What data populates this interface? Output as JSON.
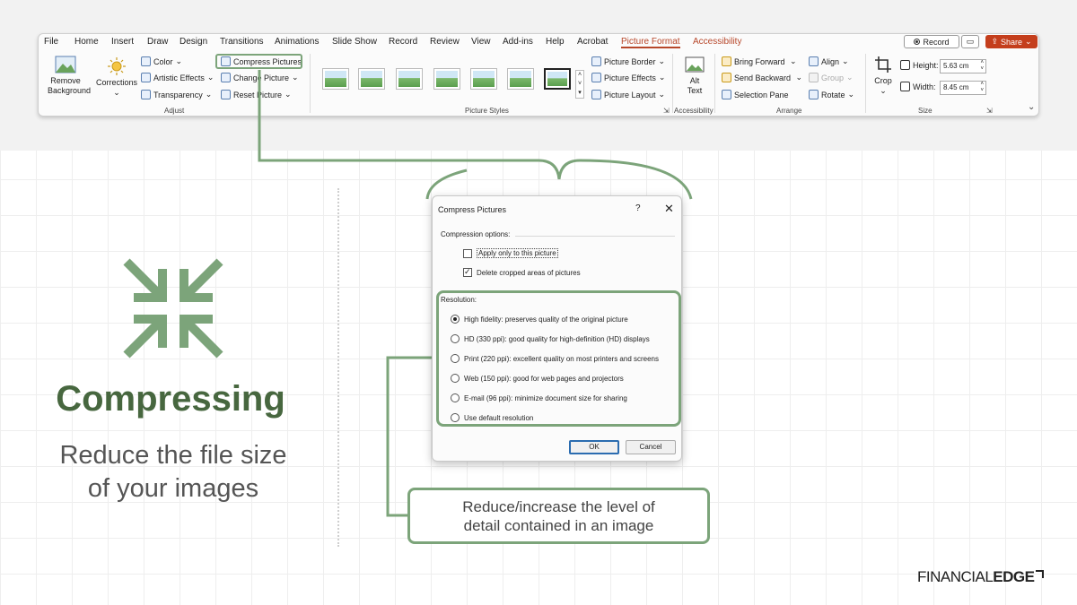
{
  "ribbon": {
    "tabs": [
      "File",
      "Home",
      "Insert",
      "Draw",
      "Design",
      "Transitions",
      "Animations",
      "Slide Show",
      "Record",
      "Review",
      "View",
      "Add-ins",
      "Help",
      "Acrobat",
      "Picture Format",
      "Accessibility"
    ],
    "record_label": "Record",
    "share_label": "Share",
    "adjust": {
      "remove_background": [
        "Remove",
        "Background"
      ],
      "corrections": "Corrections",
      "color": "Color",
      "artistic_effects": "Artistic Effects",
      "transparency": "Transparency",
      "compress_pictures": "Compress Pictures",
      "change_picture": "Change Picture",
      "reset_picture": "Reset Picture",
      "group_label": "Adjust"
    },
    "picture_styles": {
      "picture_border": "Picture Border",
      "picture_effects": "Picture Effects",
      "picture_layout": "Picture Layout",
      "group_label": "Picture Styles"
    },
    "accessibility": {
      "alt_text": [
        "Alt",
        "Text"
      ],
      "group_label": "Accessibility"
    },
    "arrange": {
      "bring_forward": "Bring Forward",
      "send_backward": "Send Backward",
      "selection_pane": "Selection Pane",
      "align": "Align",
      "group": "Group",
      "rotate": "Rotate",
      "group_label": "Arrange"
    },
    "size": {
      "crop": "Crop",
      "height_label": "Height:",
      "height_value": "5.63 cm",
      "width_label": "Width:",
      "width_value": "8.45 cm",
      "group_label": "Size"
    }
  },
  "dialog": {
    "title": "Compress Pictures",
    "help": "?",
    "close": "✕",
    "compression_options_label": "Compression options:",
    "apply_only": "Apply only to this picture",
    "delete_cropped": "Delete cropped areas of pictures",
    "resolution_label": "Resolution:",
    "options": [
      "High fidelity: preserves quality of the original picture",
      "HD (330 ppi): good quality for high-definition (HD) displays",
      "Print (220 ppi): excellent quality on most printers and screens",
      "Web (150 ppi): good for web pages and projectors",
      "E-mail (96 ppi): minimize document size for sharing",
      "Use default resolution"
    ],
    "ok": "OK",
    "cancel": "Cancel"
  },
  "callout": [
    "Reduce/increase the level of",
    "detail contained in an image"
  ],
  "left": {
    "title": "Compressing",
    "subtitle": [
      "Reduce the file size",
      "of your images"
    ]
  },
  "logo": {
    "part1": "FINANCIAL",
    "part2": "EDGE"
  },
  "colors": {
    "accent_green": "#7ca47a",
    "title_green": "#47673f",
    "office_red": "#b7472a",
    "share_red": "#c43e1c"
  }
}
